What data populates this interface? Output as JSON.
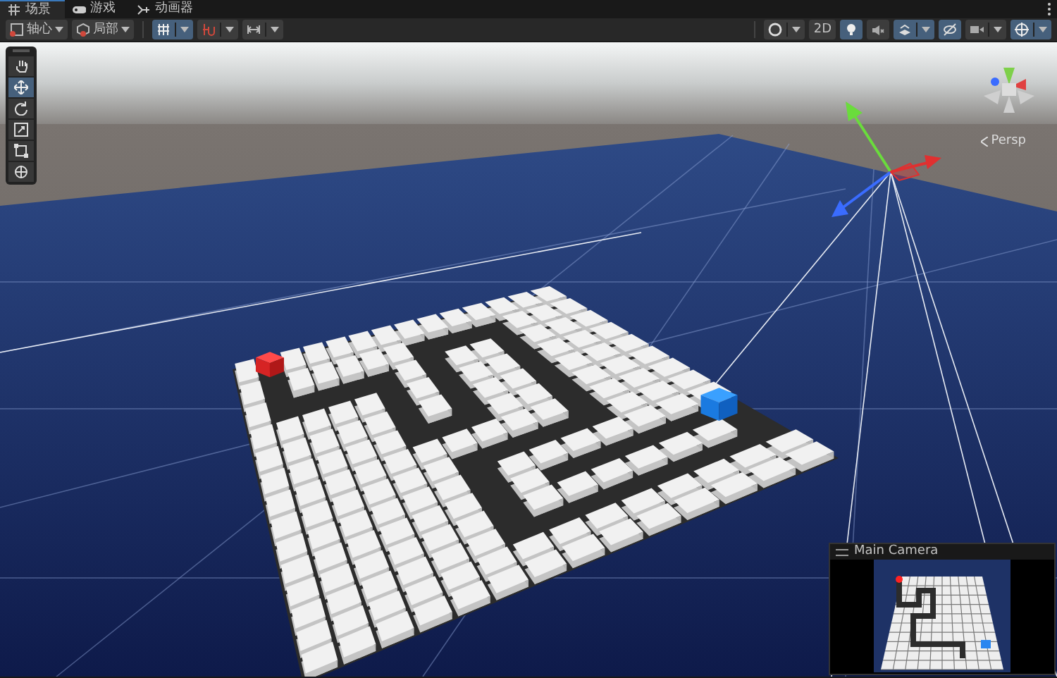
{
  "tabs": [
    {
      "label": "场景",
      "selected": true
    },
    {
      "label": "游戏",
      "selected": false
    },
    {
      "label": "动画器",
      "selected": false
    }
  ],
  "toolbar_left": [
    {
      "kind": "dropdown",
      "label": "轴心"
    },
    {
      "kind": "dropdown",
      "label": "局部"
    },
    {
      "kind": "split",
      "on": true
    },
    {
      "kind": "split",
      "on": false
    },
    {
      "kind": "split",
      "on": false
    }
  ],
  "toolbar_right": [
    {
      "kind": "split",
      "on": false
    },
    {
      "kind": "toggle",
      "label": "2D",
      "on": false
    },
    {
      "kind": "toggle",
      "on": true
    },
    {
      "kind": "toggle",
      "on": false
    },
    {
      "kind": "split",
      "on": true
    },
    {
      "kind": "toggle",
      "on": true
    },
    {
      "kind": "split",
      "on": false
    },
    {
      "kind": "split",
      "on": true
    }
  ],
  "tools": [
    {
      "selected": false
    },
    {
      "selected": true
    },
    {
      "selected": false
    },
    {
      "selected": false
    },
    {
      "selected": false
    },
    {
      "selected": false
    }
  ],
  "orientation": {
    "label": "Persp"
  },
  "camera_preview": {
    "title": "Main Camera"
  }
}
